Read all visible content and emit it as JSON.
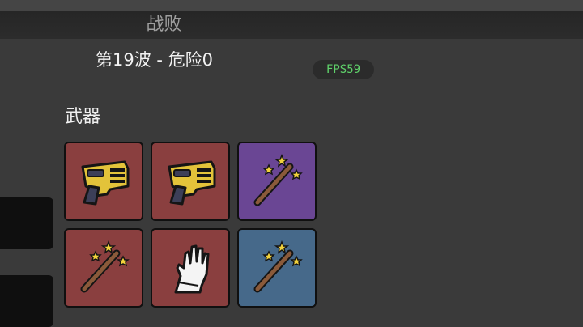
{
  "header": {
    "title": "战败"
  },
  "wave_info": "第19波 - 危险0",
  "fps": "FPS59",
  "weapons": {
    "label": "武器",
    "slots": [
      {
        "icon": "taser-icon",
        "rarity_color": "#8a3f3f"
      },
      {
        "icon": "taser-icon",
        "rarity_color": "#8a3f3f"
      },
      {
        "icon": "magic-wand-icon",
        "rarity_color": "#6a4694"
      },
      {
        "icon": "magic-wand-icon",
        "rarity_color": "#8a3f3f"
      },
      {
        "icon": "glove-icon",
        "rarity_color": "#8a3f3f"
      },
      {
        "icon": "magic-wand-icon",
        "rarity_color": "#46698a"
      }
    ]
  },
  "colors": {
    "fps": "#5fd16a",
    "tier_red": "#8a3f3f",
    "tier_purple": "#6a4694",
    "tier_blue": "#46698a"
  }
}
